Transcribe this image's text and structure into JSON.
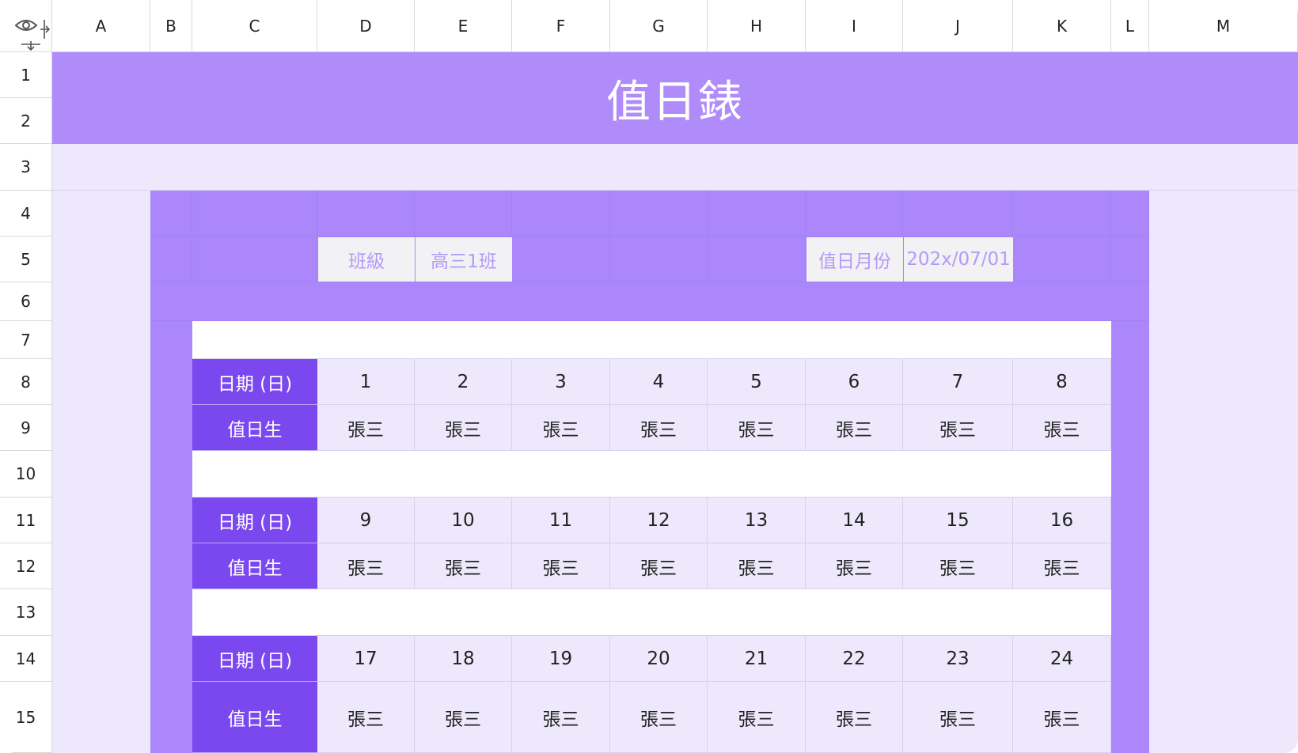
{
  "columns": [
    "A",
    "B",
    "C",
    "D",
    "E",
    "F",
    "G",
    "H",
    "I",
    "J",
    "K",
    "L",
    "M"
  ],
  "rows": [
    "1",
    "2",
    "3",
    "4",
    "5",
    "6",
    "7",
    "8",
    "9",
    "10",
    "11",
    "12",
    "13",
    "14",
    "15"
  ],
  "title": "值日錶",
  "info": {
    "class_label": "班級",
    "class_value": "高三1班",
    "month_label": "值日月份",
    "month_value": "202x/07/01"
  },
  "blocks": [
    {
      "date_label": "日期 (日)",
      "duty_label": "值日生",
      "dates": [
        "1",
        "2",
        "3",
        "4",
        "5",
        "6",
        "7",
        "8"
      ],
      "names": [
        "張三",
        "張三",
        "張三",
        "張三",
        "張三",
        "張三",
        "張三",
        "張三"
      ]
    },
    {
      "date_label": "日期 (日)",
      "duty_label": "值日生",
      "dates": [
        "9",
        "10",
        "11",
        "12",
        "13",
        "14",
        "15",
        "16"
      ],
      "names": [
        "張三",
        "張三",
        "張三",
        "張三",
        "張三",
        "張三",
        "張三",
        "張三"
      ]
    },
    {
      "date_label": "日期 (日)",
      "duty_label": "值日生",
      "dates": [
        "17",
        "18",
        "19",
        "20",
        "21",
        "22",
        "23",
        "24"
      ],
      "names": [
        "張三",
        "張三",
        "張三",
        "張三",
        "張三",
        "張三",
        "張三",
        "張三"
      ]
    }
  ],
  "colors": {
    "header_band": "#b08cfb",
    "light_band": "#ede8fb",
    "frame": "#ab87fb",
    "label_cell": "#7b48f0",
    "data_cell": "#ede8fb"
  },
  "icons": [
    "eye-icon",
    "expand-columns-icon",
    "expand-rows-icon"
  ]
}
